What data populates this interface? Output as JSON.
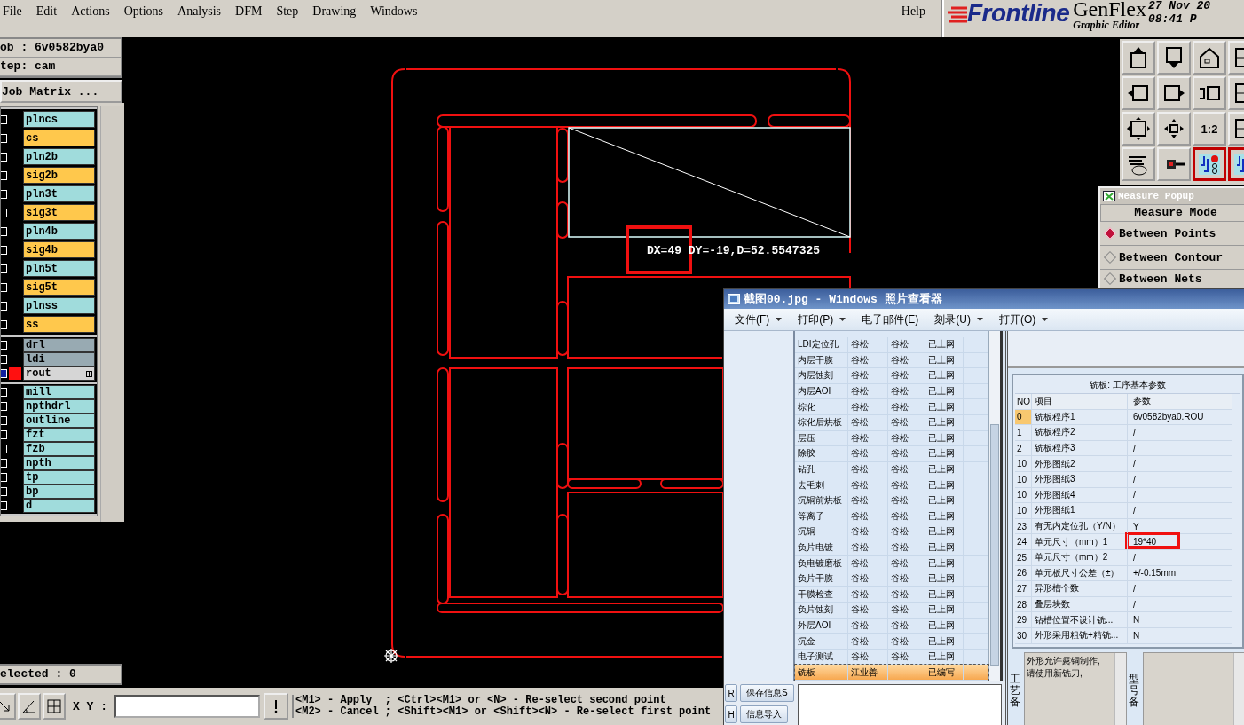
{
  "menu": {
    "items": [
      "File",
      "Edit",
      "Actions",
      "Options",
      "Analysis",
      "DFM",
      "Step",
      "Drawing",
      "Windows"
    ],
    "help": "Help"
  },
  "brand": {
    "logo": "Frontline",
    "product": "GenFlex",
    "subtitle": "Graphic Editor",
    "date": "27 Nov 20",
    "time": "08:41 P"
  },
  "job": {
    "job_line": "ob : 6v0582bya0",
    "step_line": "tep: cam",
    "matrix_button": "Job Matrix ..."
  },
  "layer_groups": [
    {
      "layers": [
        {
          "name": "plncs",
          "color": "#a0dcdc",
          "work": false
        },
        {
          "name": "cs",
          "color": "#ffc84c",
          "work": false
        },
        {
          "name": "pln2b",
          "color": "#a0dcdc",
          "work": false
        },
        {
          "name": "sig2b",
          "color": "#ffc84c",
          "work": false
        },
        {
          "name": "pln3t",
          "color": "#a0dcdc",
          "work": false
        },
        {
          "name": "sig3t",
          "color": "#ffc84c",
          "work": false
        },
        {
          "name": "pln4b",
          "color": "#a0dcdc",
          "work": false
        },
        {
          "name": "sig4b",
          "color": "#ffc84c",
          "work": false
        },
        {
          "name": "pln5t",
          "color": "#a0dcdc",
          "work": false
        },
        {
          "name": "sig5t",
          "color": "#ffc84c",
          "work": false
        },
        {
          "name": "plnss",
          "color": "#a0dcdc",
          "work": false
        },
        {
          "name": "ss",
          "color": "#ffc84c",
          "work": false
        }
      ]
    },
    {
      "layers": [
        {
          "name": "drl",
          "color": "#98aab2",
          "work": false
        },
        {
          "name": "ldi",
          "color": "#98aab2",
          "work": false
        },
        {
          "name": "rout",
          "color": "#d6d6d6",
          "work": true
        }
      ]
    },
    {
      "layers": [
        {
          "name": "mill",
          "color": "#a0dcdc",
          "work": false
        },
        {
          "name": "npthdrl",
          "color": "#a0dcdc",
          "work": false
        },
        {
          "name": "outline",
          "color": "#a0dcdc",
          "work": false
        },
        {
          "name": "fzt",
          "color": "#a0dcdc",
          "work": false
        },
        {
          "name": "fzb",
          "color": "#a0dcdc",
          "work": false
        },
        {
          "name": "npth",
          "color": "#a0dcdc",
          "work": false
        },
        {
          "name": "tp",
          "color": "#a0dcdc",
          "work": false
        },
        {
          "name": "bp",
          "color": "#a0dcdc",
          "work": false
        },
        {
          "name": "d",
          "color": "#a0dcdc",
          "work": false
        }
      ]
    }
  ],
  "selected_count": "elected : 0",
  "canvas": {
    "measure_readout": "DX=49 DY=-19,D=52.5547325",
    "readout_highlighted": true
  },
  "toolbar": {
    "ratio_label": "1:2"
  },
  "measure_popup": {
    "title": "Measure Popup",
    "header": "Measure Mode",
    "modes": [
      {
        "label": "Between Points",
        "selected": true
      },
      {
        "label": "Between Contour",
        "selected": false
      },
      {
        "label": "Between Nets",
        "selected": false
      }
    ]
  },
  "photo_viewer": {
    "title": "截图00.jpg - Windows 照片查看器",
    "menu": [
      {
        "label": "文件(F)",
        "dropdown": true
      },
      {
        "label": "打印(P)",
        "dropdown": true
      },
      {
        "label": "电子邮件(E)",
        "dropdown": false
      },
      {
        "label": "刻录(U)",
        "dropdown": true
      },
      {
        "label": "打开(O)",
        "dropdown": true
      }
    ],
    "process_rows": [
      {
        "column_1": "LDI定位孔",
        "column_2": "谷松",
        "column_3": "谷松",
        "column_4": "已上网",
        "selected": false
      },
      {
        "column_1": "内层干膜",
        "column_2": "谷松",
        "column_3": "谷松",
        "column_4": "已上网",
        "selected": false
      },
      {
        "column_1": "内层蚀刻",
        "column_2": "谷松",
        "column_3": "谷松",
        "column_4": "已上网",
        "selected": false
      },
      {
        "column_1": "内层AOI",
        "column_2": "谷松",
        "column_3": "谷松",
        "column_4": "已上网",
        "selected": false
      },
      {
        "column_1": "棕化",
        "column_2": "谷松",
        "column_3": "谷松",
        "column_4": "已上网",
        "selected": false
      },
      {
        "column_1": "棕化后烘板",
        "column_2": "谷松",
        "column_3": "谷松",
        "column_4": "已上网",
        "selected": false
      },
      {
        "column_1": "层压",
        "column_2": "谷松",
        "column_3": "谷松",
        "column_4": "已上网",
        "selected": false
      },
      {
        "column_1": "除胶",
        "column_2": "谷松",
        "column_3": "谷松",
        "column_4": "已上网",
        "selected": false
      },
      {
        "column_1": "钻孔",
        "column_2": "谷松",
        "column_3": "谷松",
        "column_4": "已上网",
        "selected": false
      },
      {
        "column_1": "去毛刺",
        "column_2": "谷松",
        "column_3": "谷松",
        "column_4": "已上网",
        "selected": false
      },
      {
        "column_1": "沉铜前烘板",
        "column_2": "谷松",
        "column_3": "谷松",
        "column_4": "已上网",
        "selected": false
      },
      {
        "column_1": "等离子",
        "column_2": "谷松",
        "column_3": "谷松",
        "column_4": "已上网",
        "selected": false
      },
      {
        "column_1": "沉铜",
        "column_2": "谷松",
        "column_3": "谷松",
        "column_4": "已上网",
        "selected": false
      },
      {
        "column_1": "负片电镀",
        "column_2": "谷松",
        "column_3": "谷松",
        "column_4": "已上网",
        "selected": false
      },
      {
        "column_1": "负电镀磨板",
        "column_2": "谷松",
        "column_3": "谷松",
        "column_4": "已上网",
        "selected": false
      },
      {
        "column_1": "负片干膜",
        "column_2": "谷松",
        "column_3": "谷松",
        "column_4": "已上网",
        "selected": false
      },
      {
        "column_1": "干膜检查",
        "column_2": "谷松",
        "column_3": "谷松",
        "column_4": "已上网",
        "selected": false
      },
      {
        "column_1": "负片蚀刻",
        "column_2": "谷松",
        "column_3": "谷松",
        "column_4": "已上网",
        "selected": false
      },
      {
        "column_1": "外层AOI",
        "column_2": "谷松",
        "column_3": "谷松",
        "column_4": "已上网",
        "selected": false
      },
      {
        "column_1": "沉金",
        "column_2": "谷松",
        "column_3": "谷松",
        "column_4": "已上网",
        "selected": false
      },
      {
        "column_1": "电子测试",
        "column_2": "谷松",
        "column_3": "谷松",
        "column_4": "已上网",
        "selected": false
      },
      {
        "column_1": "铣板",
        "column_2": "江业善",
        "column_4": "已编写",
        "selected": true
      }
    ],
    "side_buttons": [
      {
        "shortcut": "R",
        "label": "保存信息S"
      },
      {
        "shortcut": "H",
        "label": "信息导入"
      }
    ],
    "param_panel": {
      "title": "铣板: 工序基本参数",
      "columns": [
        "NO",
        "项目",
        "参数"
      ],
      "rows": [
        {
          "no": "0",
          "item": "铣板程序1",
          "value": "6v0582bya0.ROU",
          "selected": true,
          "highlighted": false
        },
        {
          "no": "1",
          "item": "铣板程序2",
          "value": "/",
          "selected": false,
          "highlighted": false
        },
        {
          "no": "2",
          "item": "铣板程序3",
          "value": "/",
          "selected": false,
          "highlighted": false
        },
        {
          "no": "10",
          "item": "外形图纸2",
          "value": "/",
          "selected": false,
          "highlighted": false
        },
        {
          "no": "10",
          "item": "外形图纸3",
          "value": "/",
          "selected": false,
          "highlighted": false
        },
        {
          "no": "10",
          "item": "外形图纸4",
          "value": "/",
          "selected": false,
          "highlighted": false
        },
        {
          "no": "10",
          "item": "外形图纸1",
          "value": "/",
          "selected": false,
          "highlighted": false
        },
        {
          "no": "23",
          "item": "有无内定位孔（Y/N）",
          "value": "Y",
          "selected": false,
          "highlighted": false
        },
        {
          "no": "24",
          "item": "单元尺寸（mm）1",
          "value": "19*40",
          "selected": false,
          "highlighted": true
        },
        {
          "no": "25",
          "item": "单元尺寸（mm）2",
          "value": "/",
          "selected": false,
          "highlighted": false
        },
        {
          "no": "26",
          "item": "单元板尺寸公差（±）",
          "value": "+/-0.15mm",
          "selected": false,
          "highlighted": false
        },
        {
          "no": "27",
          "item": "异形槽个数",
          "value": "/",
          "selected": false,
          "highlighted": false
        },
        {
          "no": "28",
          "item": "叠层块数",
          "value": "/",
          "selected": false,
          "highlighted": false
        },
        {
          "no": "29",
          "item": "钻槽位置不设计铣...",
          "value": "N",
          "selected": false,
          "highlighted": false
        },
        {
          "no": "30",
          "item": "外形采用粗铣+精铣...",
          "value": "N",
          "selected": false,
          "highlighted": false
        }
      ]
    },
    "memos": [
      {
        "label": "工艺备",
        "lines": [
          "外形允许露铜制作,",
          "请使用新铣刀,"
        ]
      },
      {
        "label": "型号备"
      }
    ]
  },
  "bottom_bar": {
    "xy_label": "X Y :",
    "help_lines": [
      "<M1> - Apply  ; <Ctrl><M1> or <N> - Re-select second point",
      "<M2> - Cancel ; <Shift><M1> or <Shift><N> - Re-select first point"
    ]
  }
}
